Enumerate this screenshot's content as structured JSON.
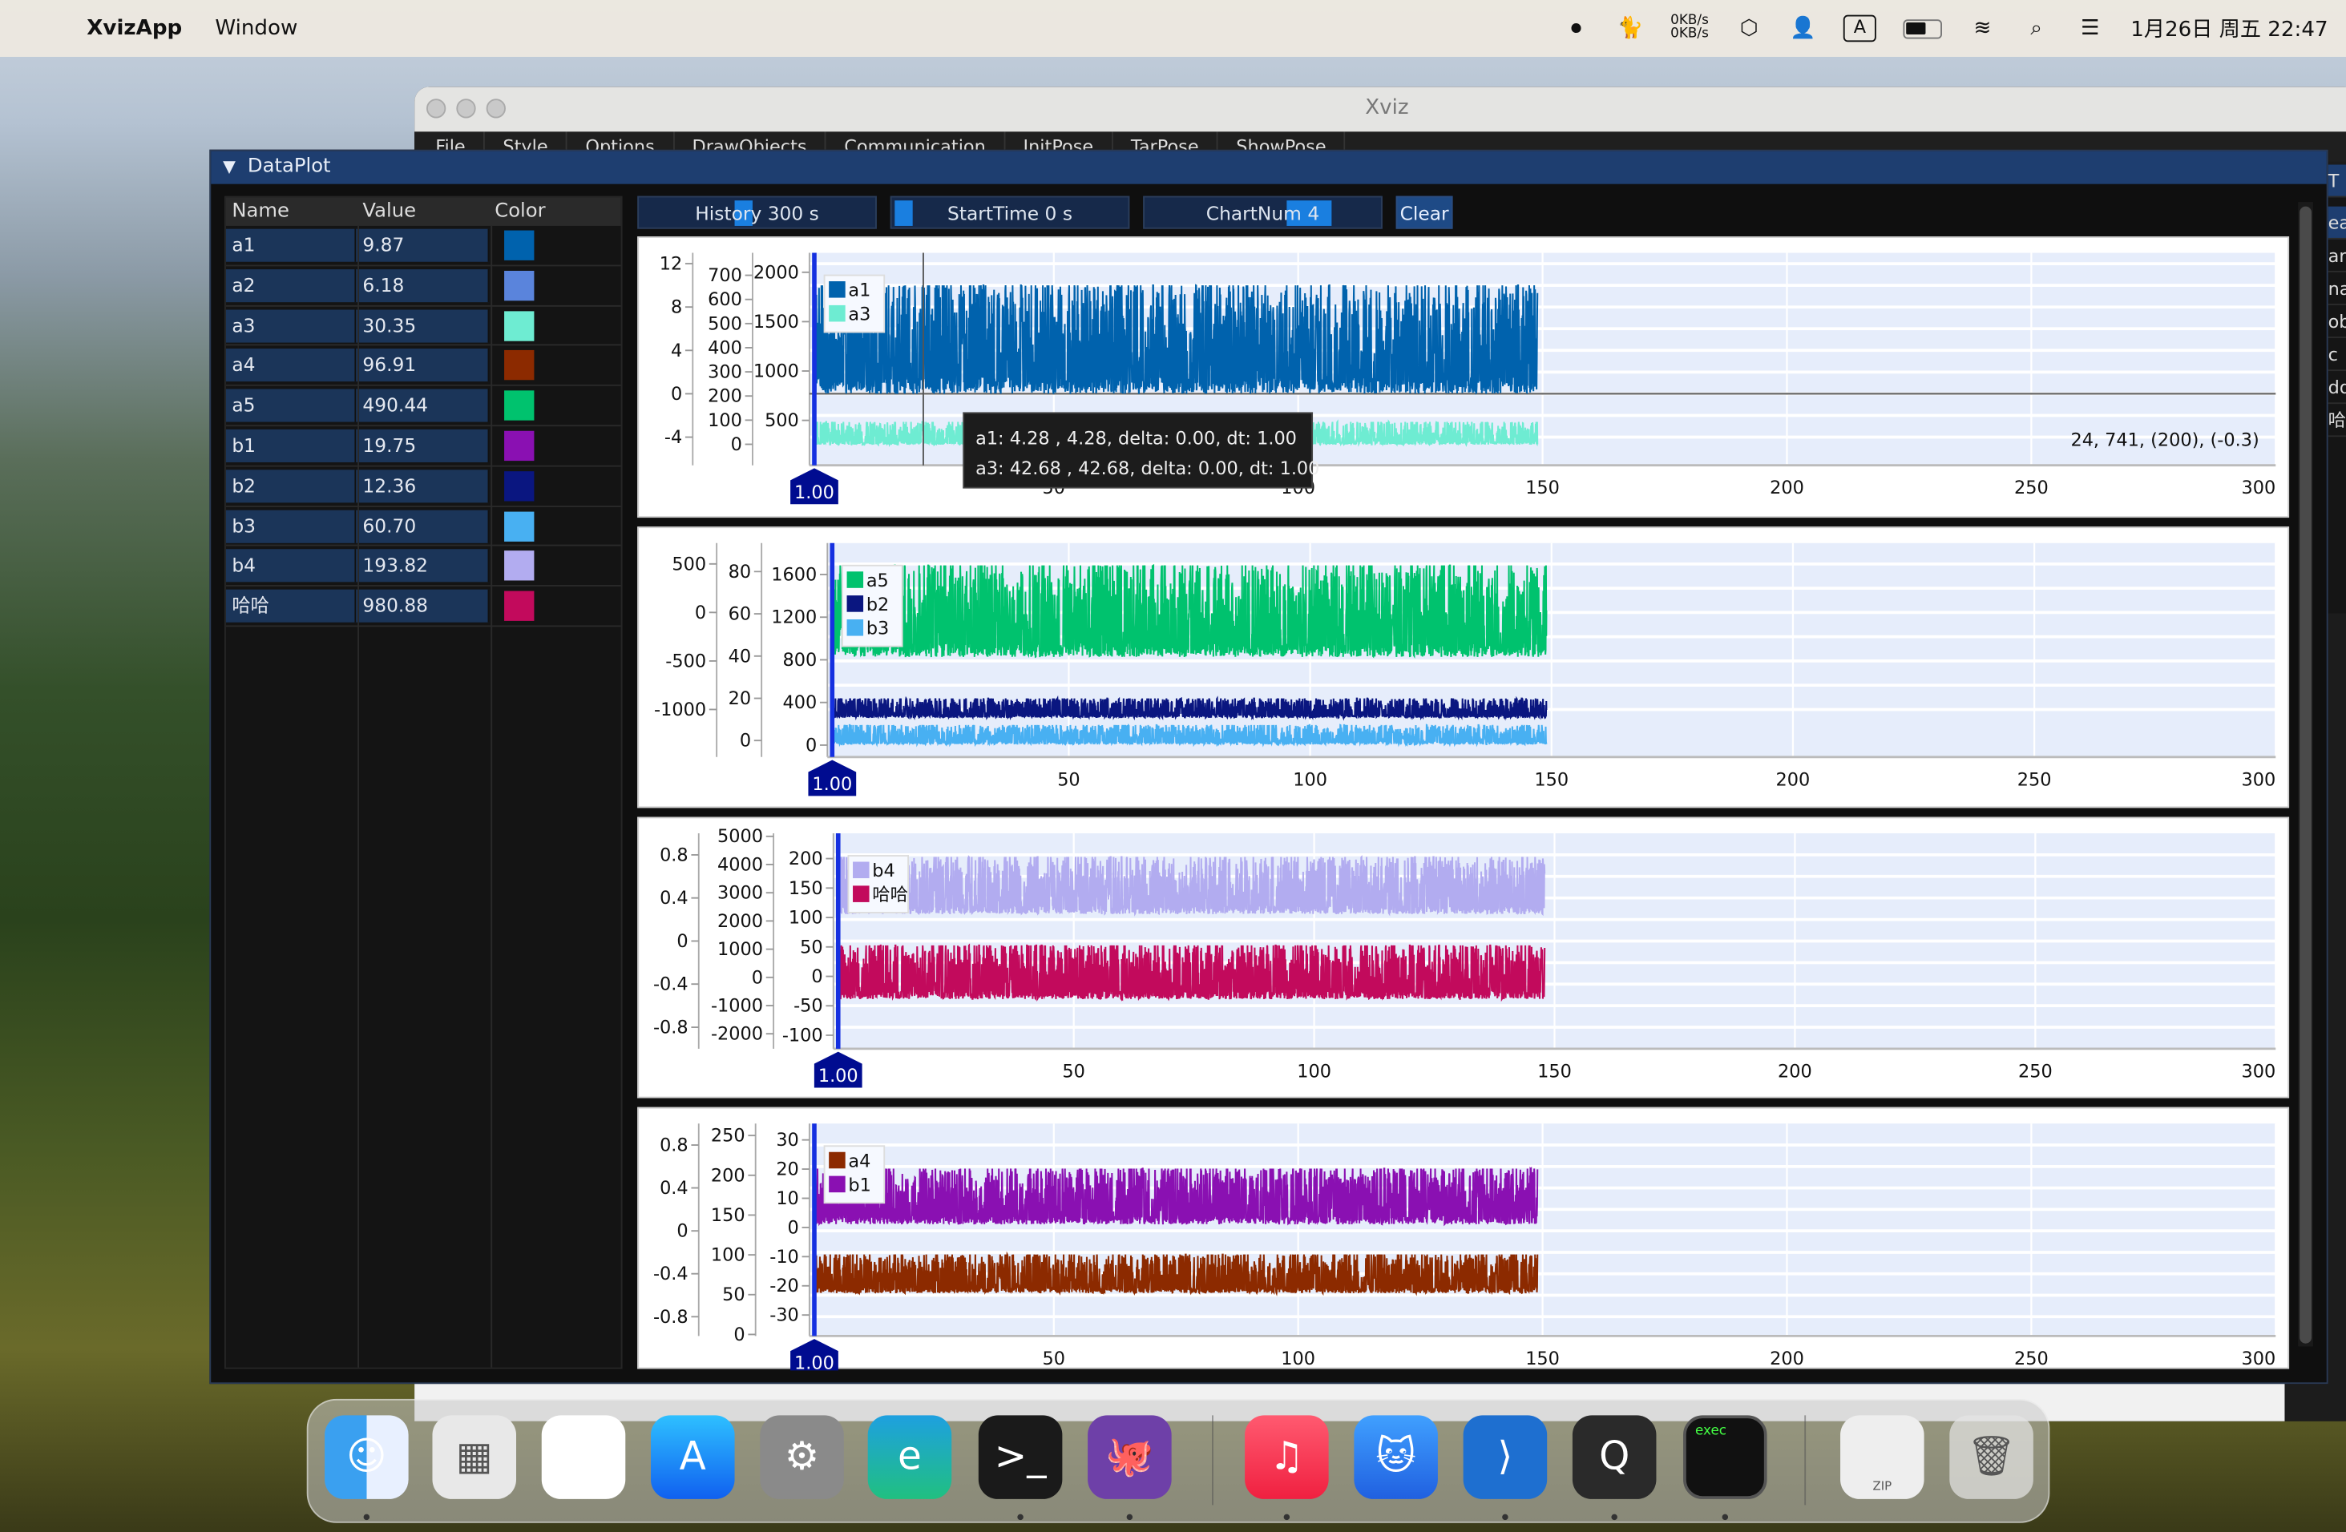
{
  "menubar": {
    "app": "XvizApp",
    "items": [
      "Window"
    ],
    "net_up": "0KB/s",
    "net_down": "0KB/s",
    "input_source": "A",
    "datetime": "1月26日 周五  22:47"
  },
  "window": {
    "title": "Xviz",
    "menu": [
      "File",
      "Style",
      "Options",
      "DrawObjects",
      "Communication",
      "InitPose",
      "TarPose",
      "ShowPose"
    ]
  },
  "panel": {
    "title": "DataPlot"
  },
  "table": {
    "headers": [
      "Name",
      "Value",
      "Color"
    ],
    "rows": [
      {
        "name": "a1",
        "value": "9.87",
        "color": "#0062ad"
      },
      {
        "name": "a2",
        "value": "6.18",
        "color": "#5a84dc"
      },
      {
        "name": "a3",
        "value": "30.35",
        "color": "#6eecd2"
      },
      {
        "name": "a4",
        "value": "96.91",
        "color": "#8c2a00"
      },
      {
        "name": "a5",
        "value": "490.44",
        "color": "#00c26e"
      },
      {
        "name": "b1",
        "value": "19.75",
        "color": "#8a10b2"
      },
      {
        "name": "b2",
        "value": "12.36",
        "color": "#0a1680"
      },
      {
        "name": "b3",
        "value": "60.70",
        "color": "#48b0f2"
      },
      {
        "name": "b4",
        "value": "193.82",
        "color": "#b2acf0"
      },
      {
        "name": "哈哈",
        "value": "980.88",
        "color": "#c20a5c"
      }
    ]
  },
  "toolbar": {
    "history": {
      "label": "History 300 s",
      "value": 300
    },
    "starttime": {
      "label": "StartTime 0 s",
      "value": 0
    },
    "chartnum": {
      "label": "ChartNum 4",
      "value": 4
    },
    "clear": "Clear"
  },
  "side_fragments": [
    "T",
    "ea",
    "an",
    "na",
    "ob",
    "c",
    "dd",
    "哈"
  ],
  "dock": {
    "items": [
      "Finder",
      "Launchpad",
      "Photos",
      "App Store",
      "System Settings",
      "Edge",
      "Terminal",
      "GitHub Desktop",
      "Music",
      "Cat app",
      "VS Code",
      "QuickTime",
      "exec",
      "ZIP archive",
      "Trash"
    ],
    "exec_label": "exec",
    "zip_label": "ZIP"
  },
  "chart_data": [
    {
      "type": "line",
      "xlim": [
        0,
        300
      ],
      "xticks": [
        50,
        100,
        150,
        200,
        250,
        300
      ],
      "legend": "top-left",
      "cursor_label": "1.00",
      "grid": true,
      "y_axes": [
        {
          "ylim": [
            -6.6,
            13
          ],
          "ticks": [
            12,
            8,
            4,
            0,
            -4
          ]
        },
        {
          "ylim": [
            -87,
            793
          ],
          "ticks": [
            700,
            600,
            500,
            400,
            300,
            200,
            100,
            0
          ]
        },
        {
          "ylim": [
            45,
            2197
          ],
          "ticks": [
            2000,
            1500,
            1000,
            500
          ]
        }
      ],
      "series": [
        {
          "name": "a1",
          "color": "#0062ad",
          "x_range": [
            1,
            149
          ],
          "band": [
            0,
            10
          ]
        },
        {
          "name": "a3",
          "color": "#6eecd2",
          "x_range": [
            1,
            149
          ],
          "band": [
            -4.7,
            -2.6
          ]
        }
      ],
      "cursor_x": 23.3,
      "zero_line": 0,
      "tooltip": [
        "a1: 4.28    , 4.28, delta: 0.00, dt: 1.00",
        "a3: 42.68    , 42.68, delta: 0.00, dt: 1.00"
      ],
      "readout": "24, 741, (200), (-0.3)"
    },
    {
      "type": "line",
      "xlim": [
        0,
        300
      ],
      "xticks": [
        50,
        100,
        150,
        200,
        250,
        300
      ],
      "legend": "top-left",
      "cursor_label": "1.00",
      "grid": true,
      "y_axes": [
        {
          "ylim": [
            -1490,
            715
          ],
          "ticks": [
            500,
            0,
            -500,
            -1000
          ]
        },
        {
          "ylim": [
            -7.8,
            93.5
          ],
          "ticks": [
            80,
            60,
            40,
            20,
            0
          ]
        },
        {
          "ylim": [
            -112,
            1895
          ],
          "ticks": [
            1600,
            1200,
            800,
            400,
            0
          ]
        }
      ],
      "series": [
        {
          "name": "a5",
          "color": "#00c26e",
          "x_range": [
            1,
            149
          ],
          "band": [
            -460,
            485
          ]
        },
        {
          "name": "b2",
          "color": "#0a1680",
          "x_range": [
            1,
            149
          ],
          "band": [
            -1085,
            -885
          ]
        },
        {
          "name": "b3",
          "color": "#48b0f2",
          "x_range": [
            1,
            149
          ],
          "band": [
            -1360,
            -1160
          ]
        }
      ]
    },
    {
      "type": "line",
      "xlim": [
        0,
        300
      ],
      "xticks": [
        50,
        100,
        150,
        200,
        250,
        300
      ],
      "legend": "top-left",
      "cursor_label": "1.00",
      "grid": true,
      "y_axes": [
        {
          "ylim": [
            -1,
            1
          ],
          "ticks": [
            0.8,
            0.4,
            0,
            -0.4,
            -0.8
          ]
        },
        {
          "ylim": [
            -2530,
            5106
          ],
          "ticks": [
            5000,
            4000,
            3000,
            2000,
            1000,
            0,
            -1000,
            -2000
          ]
        },
        {
          "ylim": [
            -123,
            243
          ],
          "ticks": [
            200,
            150,
            100,
            50,
            0,
            -50,
            -100
          ]
        }
      ],
      "series": [
        {
          "name": "b4",
          "color": "#b2acf0",
          "x_range": [
            1,
            148
          ],
          "band": [
            0.25,
            0.78
          ]
        },
        {
          "name": "哈哈",
          "color": "#c20a5c",
          "x_range": [
            1,
            148
          ],
          "band": [
            -0.54,
            -0.04
          ]
        }
      ]
    },
    {
      "type": "line",
      "xlim": [
        0,
        300
      ],
      "xticks": [
        50,
        100,
        150,
        200,
        250,
        300
      ],
      "legend": "top-left",
      "cursor_label": "1.00",
      "grid": true,
      "y_axes": [
        {
          "ylim": [
            -0.98,
            1.0
          ],
          "ticks": [
            0.8,
            0.4,
            0,
            -0.4,
            -0.8
          ]
        },
        {
          "ylim": [
            -2,
            265
          ],
          "ticks": [
            250,
            200,
            150,
            100,
            50,
            0
          ]
        },
        {
          "ylim": [
            -37.2,
            35.6
          ],
          "ticks": [
            30,
            20,
            10,
            0,
            -10,
            -20,
            -30
          ]
        }
      ],
      "series": [
        {
          "name": "a4",
          "color": "#8c2a00",
          "x_range": [
            1,
            149
          ],
          "band": [
            -0.58,
            -0.22
          ]
        },
        {
          "name": "b1",
          "color": "#8a10b2",
          "x_range": [
            1,
            149
          ],
          "band": [
            0.06,
            0.58
          ]
        }
      ]
    }
  ]
}
